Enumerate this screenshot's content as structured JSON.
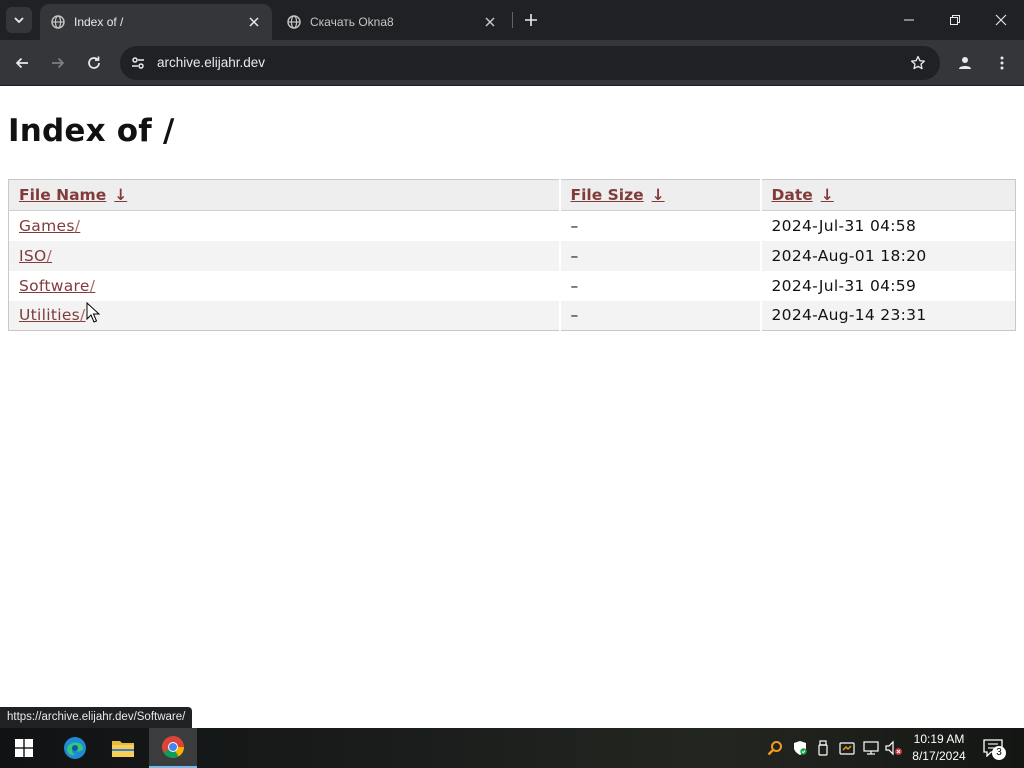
{
  "browser": {
    "tabs": [
      {
        "title": "Index of /",
        "active": true,
        "icon": "globe-icon"
      },
      {
        "title": "Скачать Okna8",
        "active": false,
        "icon": "globe-icon"
      }
    ],
    "address": "archive.elijahr.dev",
    "status_url": "https://archive.elijahr.dev/Software/"
  },
  "page": {
    "heading": "Index of /",
    "columns": [
      {
        "label": "File Name",
        "sort_arrow": "↓"
      },
      {
        "label": "File Size",
        "sort_arrow": "↓"
      },
      {
        "label": "Date",
        "sort_arrow": "↓"
      }
    ],
    "rows": [
      {
        "name": "Games",
        "slash": "/",
        "size": "–",
        "date": "2024-Jul-31 04:58"
      },
      {
        "name": "ISO",
        "slash": "/",
        "size": "–",
        "date": "2024-Aug-01 18:20"
      },
      {
        "name": "Software",
        "slash": "/",
        "size": "–",
        "date": "2024-Jul-31 04:59"
      },
      {
        "name": "Utilities",
        "slash": "/",
        "size": "–",
        "date": "2024-Aug-14 23:31"
      }
    ]
  },
  "taskbar": {
    "apps": [
      "edge-icon",
      "file-explorer-icon",
      "chrome-icon"
    ],
    "clock_time": "10:19 AM",
    "clock_date": "8/17/2024",
    "notification_count": "3"
  },
  "colors": {
    "link": "#803b3b",
    "chrome_dark": "#202124",
    "chrome_mid": "#35363a"
  }
}
